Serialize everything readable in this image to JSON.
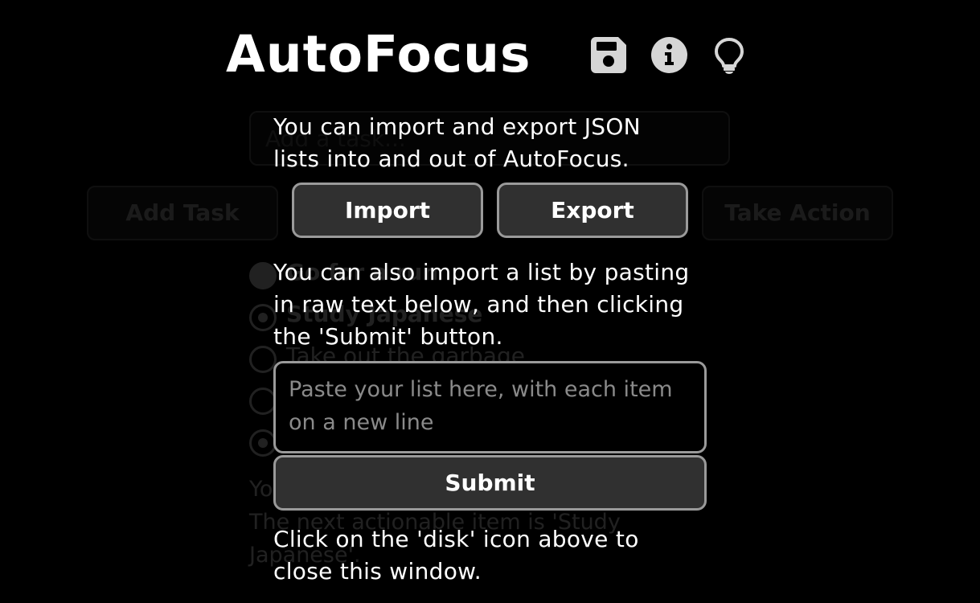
{
  "app": {
    "title": "AutoFocus"
  },
  "header_icons": [
    "disk-icon",
    "info-icon",
    "lightbulb-icon"
  ],
  "background": {
    "task_input_placeholder": "Add a task...",
    "buttons": {
      "add_task": "Add Task",
      "take_action": "Take Action"
    },
    "tasks": [
      {
        "label": "Go for a run",
        "state": "filled"
      },
      {
        "label": "Study Japanese",
        "state": "dotted"
      },
      {
        "label": "Take out the garbage",
        "state": "empty"
      },
      {
        "label": "",
        "state": "empty"
      },
      {
        "label": "",
        "state": "dotted"
      }
    ],
    "status_line_1": "Yo",
    "status_line_2": "The next actionable item is 'Study Japanese'."
  },
  "modal": {
    "intro_text": "You can import and export JSON lists into and out of AutoFocus.",
    "import_label": "Import",
    "export_label": "Export",
    "paste_text": "You can also import a list by pasting in raw text below, and then clicking the 'Submit' button.",
    "paste_placeholder": "Paste your list here, with each item on a new line",
    "submit_label": "Submit",
    "close_hint": "Click on the 'disk' icon above to close this window."
  },
  "colors": {
    "background": "#000000",
    "text": "#ffffff",
    "button_bg": "#303030",
    "button_border": "#9a9a9a",
    "icon": "#d6d6d6",
    "placeholder": "#8a8a8a"
  }
}
